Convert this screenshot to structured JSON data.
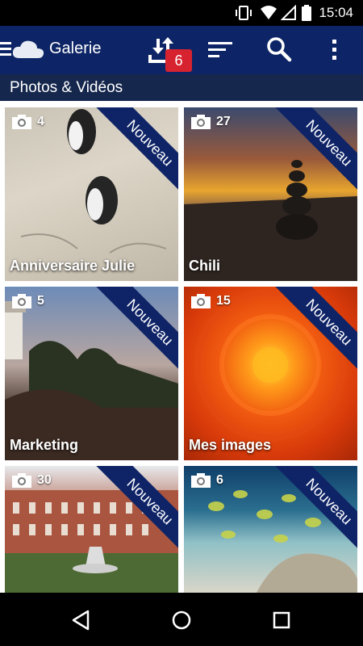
{
  "status": {
    "time": "15:04"
  },
  "app": {
    "title": "Galerie"
  },
  "toolbar": {
    "badge_count": "6"
  },
  "section": {
    "title": "Photos & Vidéos"
  },
  "ribbon_label": "Nouveau",
  "albums": [
    {
      "name": "Anniversaire Julie",
      "count": "4"
    },
    {
      "name": "Chili",
      "count": "27"
    },
    {
      "name": "Marketing",
      "count": "5"
    },
    {
      "name": "Mes images",
      "count": "15"
    },
    {
      "name": "",
      "count": "30"
    },
    {
      "name": "",
      "count": "6"
    }
  ]
}
